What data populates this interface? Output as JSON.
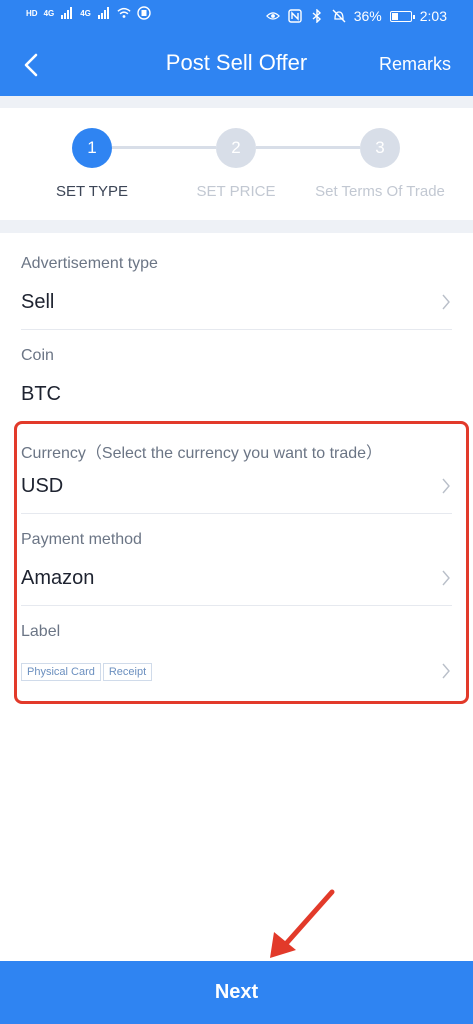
{
  "status_bar": {
    "net_labels": [
      "HD",
      "HD"
    ],
    "signal_labels": [
      "4G",
      "4G"
    ],
    "battery_percent": "36%",
    "time": "2:03",
    "battery_level": 0.36,
    "icons": [
      "wifi-icon",
      "eye-icon",
      "nfc-icon",
      "bluetooth-icon",
      "mute-icon"
    ]
  },
  "nav": {
    "title": "Post Sell Offer",
    "right_action": "Remarks",
    "back_icon": "chevron-left-icon"
  },
  "steps": [
    {
      "number": "1",
      "label": "SET TYPE",
      "active": true
    },
    {
      "number": "2",
      "label": "SET PRICE",
      "active": false
    },
    {
      "number": "3",
      "label": "Set Terms Of Trade",
      "active": false
    }
  ],
  "form": {
    "ad_type": {
      "label": "Advertisement type",
      "value": "Sell"
    },
    "coin": {
      "label": "Coin",
      "value": "BTC"
    },
    "currency": {
      "label": "Currency（Select the currency you want to trade）",
      "value": "USD"
    },
    "payment": {
      "label": "Payment method",
      "value": "Amazon"
    },
    "label": {
      "label": "Label",
      "tags": [
        "Physical Card",
        "Receipt"
      ]
    }
  },
  "colors": {
    "primary": "#2f84f2",
    "highlight": "#e23a2a"
  },
  "footer": {
    "next_label": "Next"
  }
}
